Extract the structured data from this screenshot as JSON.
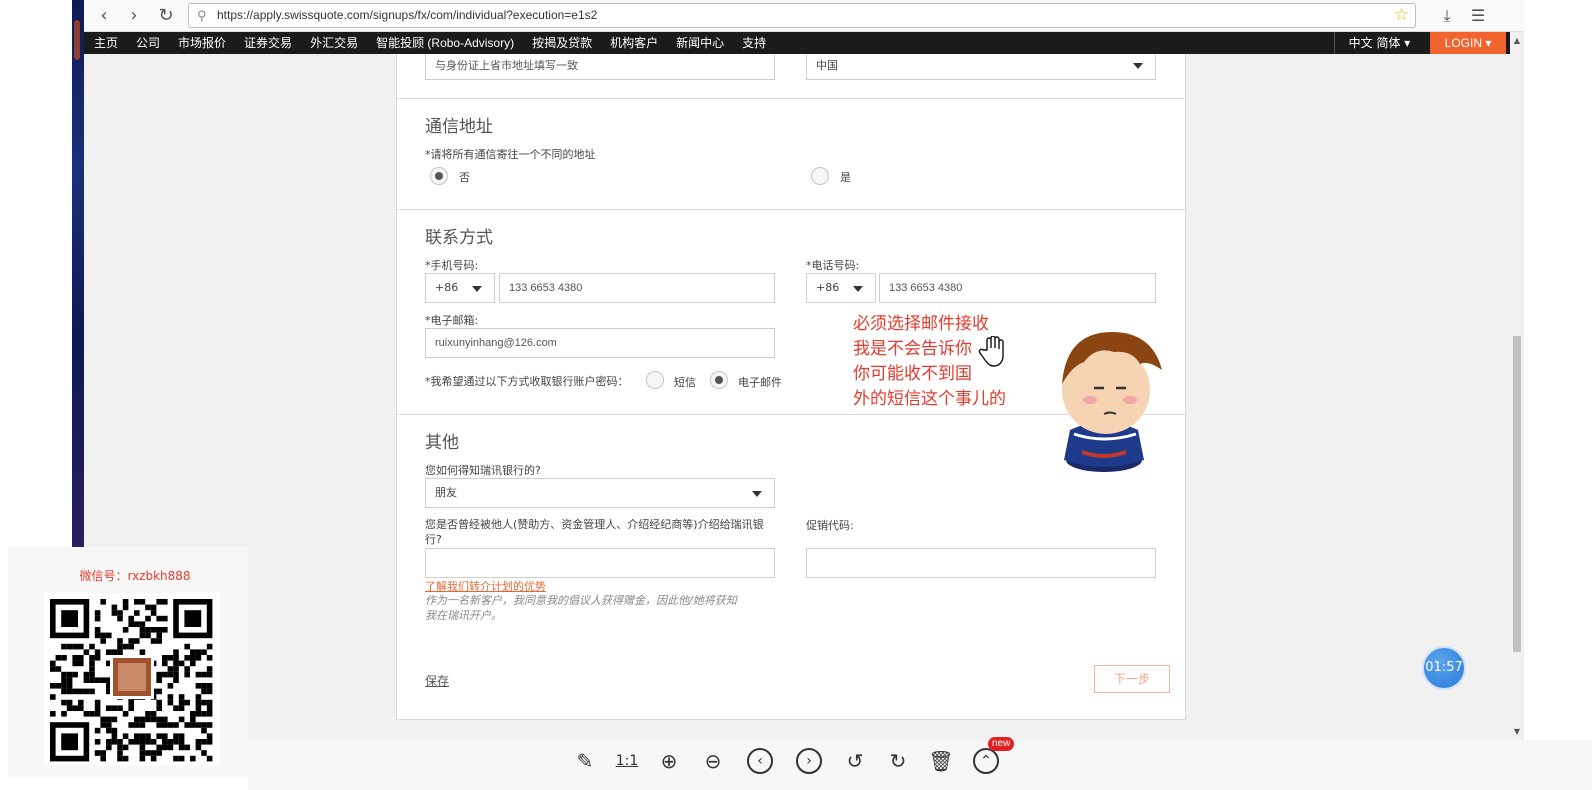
{
  "browser": {
    "url": "https://apply.swissquote.com/signups/fx/com/individual?execution=e1s2",
    "icons": [
      "back-icon",
      "forward-icon",
      "reload-icon",
      "search-icon",
      "star-icon",
      "download-icon",
      "menu-icon"
    ]
  },
  "topnav": {
    "items": [
      "主页",
      "公司",
      "市场报价",
      "证券交易",
      "外汇交易",
      "智能投顾 (Robo-Advisory)",
      "按揭及贷款",
      "机构客户",
      "新闻中心",
      "支持"
    ],
    "lang": "中文 简体 ▾",
    "login": "LOGIN ▾"
  },
  "form": {
    "address_top": {
      "province_placeholder": "与身份证上省市地址填写一致",
      "country": "中国"
    },
    "correspondence": {
      "title": "通信地址",
      "question": "*请将所有通信寄往一个不同的地址",
      "options": [
        "否",
        "是"
      ],
      "selected": "否"
    },
    "contact": {
      "title": "联系方式",
      "mobile_label": "*手机号码:",
      "mobile_code": "+86",
      "mobile_value": "133 6653 4380",
      "phone_label": "*电话号码:",
      "phone_code": "+86",
      "phone_value": "133 6653 4380",
      "email_label": "*电子邮箱:",
      "email_value": "ruixunyinhang@126.com",
      "pwd_question": "*我希望通过以下方式收取银行账户密码：",
      "pwd_options": [
        "短信",
        "电子邮件"
      ],
      "pwd_selected": "电子邮件"
    },
    "other": {
      "title": "其他",
      "how_label": "您如何得知瑞讯银行的?",
      "how_value": "朋友",
      "referred_label": "您是否曾经被他人(赞助方、资金管理人、介绍经纪商等)介绍给瑞讯银行?",
      "promo_label": "促销代码:",
      "referral_link": "了解我们转介计划的优势",
      "referral_note": "作为一名新客户，我同意我的倡议人获得赠金，因此他/她将获知我在瑞讯开户。"
    },
    "save": "保存",
    "next": "下一步"
  },
  "annotation": [
    "必须选择邮件接收",
    "我是不会告诉你",
    "你可能收不到国",
    "外的短信这个事儿的"
  ],
  "timer": "01:57",
  "wechat": {
    "label": "微信号：rxzbkh888"
  },
  "toolbar": {
    "ratio": "1:1",
    "new_badge": "new"
  },
  "colors": {
    "accent": "#f2642d",
    "annotation": "#e53a2d",
    "timer": "#2b78d8"
  }
}
